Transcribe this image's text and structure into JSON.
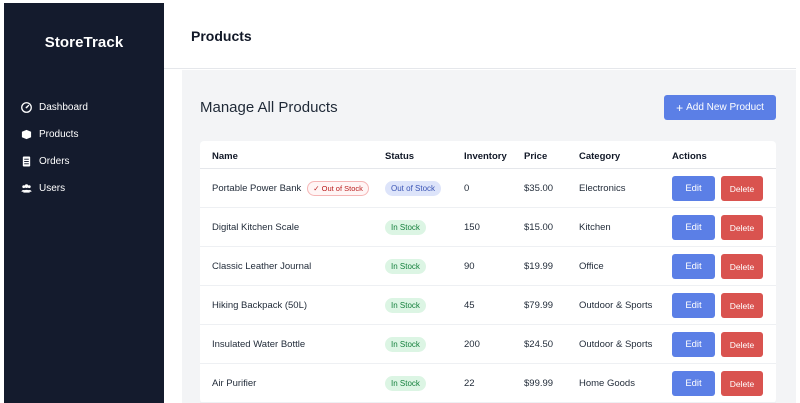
{
  "sidebar": {
    "brand": "StoreTrack",
    "items": [
      {
        "label": "Dashboard",
        "icon": "dashboard-icon"
      },
      {
        "label": "Products",
        "icon": "products-icon"
      },
      {
        "label": "Orders",
        "icon": "orders-icon"
      },
      {
        "label": "Users",
        "icon": "users-icon"
      }
    ]
  },
  "header": {
    "title": "Products"
  },
  "main": {
    "title": "Manage All Products",
    "add_button_label": "Add New Product",
    "add_button_icon": "plus-icon"
  },
  "table": {
    "columns": [
      "Name",
      "Status",
      "Inventory",
      "Price",
      "Category",
      "Actions"
    ],
    "edit_label": "Edit",
    "delete_label": "Delete",
    "rows": [
      {
        "name": "Portable Power Bank",
        "flag": "✓ Out of Stock",
        "status": "Out of Stock",
        "inventory": "0",
        "price": "$35.00",
        "category": "Electronics"
      },
      {
        "name": "Digital Kitchen Scale",
        "flag": "",
        "status": "In Stock",
        "inventory": "150",
        "price": "$15.00",
        "category": "Kitchen"
      },
      {
        "name": "Classic Leather Journal",
        "flag": "",
        "status": "In Stock",
        "inventory": "90",
        "price": "$19.99",
        "category": "Office"
      },
      {
        "name": "Hiking Backpack (50L)",
        "flag": "",
        "status": "In Stock",
        "inventory": "45",
        "price": "$79.99",
        "category": "Outdoor & Sports"
      },
      {
        "name": "Insulated Water Bottle",
        "flag": "",
        "status": "In Stock",
        "inventory": "200",
        "price": "$24.50",
        "category": "Outdoor & Sports"
      },
      {
        "name": "Air Purifier",
        "flag": "",
        "status": "In Stock",
        "inventory": "22",
        "price": "$99.99",
        "category": "Home Goods"
      }
    ]
  },
  "colors": {
    "sidebar_bg": "#141b2d",
    "primary": "#5b7fe6",
    "danger": "#d9534f",
    "in_stock_bg": "#dcf5e4",
    "in_stock_text": "#15803d",
    "out_stock_bg": "#dde4fa",
    "out_stock_text": "#3b55b5"
  }
}
